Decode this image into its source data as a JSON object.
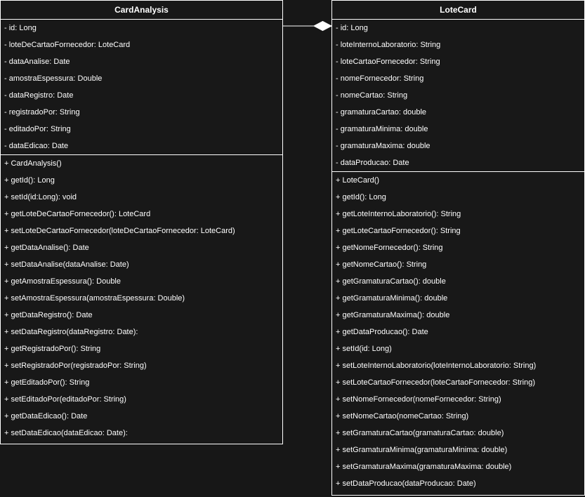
{
  "classes": [
    {
      "name": "CardAnalysis",
      "attributes": [
        "- id: Long",
        "- loteDeCartaoFornecedor: LoteCard",
        "- dataAnalise: Date",
        "- amostraEspessura: Double",
        "- dataRegistro: Date",
        "- registradoPor: String",
        "- editadoPor: String",
        "- dataEdicao: Date"
      ],
      "methods": [
        "+ CardAnalysis()",
        "+ getId(): Long",
        "+ setId(id:Long): void",
        "+ getLoteDeCartaoFornecedor(): LoteCard",
        "+ setLoteDeCartaoFornecedor(loteDeCartaoFornecedor: LoteCard)",
        "+ getDataAnalise(): Date",
        "+ setDataAnalise(dataAnalise: Date)",
        "+ getAmostraEspessura(): Double",
        "+ setAmostraEspessura(amostraEspessura: Double)",
        "+ getDataRegistro(): Date",
        "+ setDataRegistro(dataRegistro: Date):",
        "+ getRegistradoPor(): String",
        "+ setRegistradoPor(registradoPor: String)",
        "+ getEditadoPor(): String",
        "+ setEditadoPor(editadoPor: String)",
        "+ getDataEdicao(): Date",
        "+ setDataEdicao(dataEdicao: Date):"
      ]
    },
    {
      "name": "LoteCard",
      "attributes": [
        "- id: Long",
        "- loteInternoLaboratorio: String",
        "- loteCartaoFornecedor: String",
        "- nomeFornecedor: String",
        "- nomeCartao: String",
        "- gramaturaCartao: double",
        "- gramaturaMinima: double",
        "- gramaturaMaxima: double",
        "- dataProducao: Date"
      ],
      "methods": [
        "+ LoteCard()",
        "+ getId(): Long",
        "+ getLoteInternoLaboratorio(): String",
        "+ getLoteCartaoFornecedor(): String",
        "+ getNomeFornecedor(): String",
        "+ getNomeCartao(): String",
        "+ getGramaturaCartao(): double",
        "+ getGramaturaMinima(): double",
        "+ getGramaturaMaxima(): double",
        "+ getDataProducao(): Date",
        "+ setId(id: Long)",
        "+ setLoteInternoLaboratorio(loteInternoLaboratorio: String)",
        "+ setLoteCartaoFornecedor(loteCartaoFornecedor: String)",
        "+ setNomeFornecedor(nomeFornecedor: String)",
        "+ setNomeCartao(nomeCartao: String)",
        "+ setGramaturaCartao(gramaturaCartao: double)",
        "+ setGramaturaMinima(gramaturaMinima: double)",
        "+ setGramaturaMaxima(gramaturaMaxima: double)",
        "+ setDataProducao(dataProducao: Date)"
      ]
    }
  ],
  "relationship": {
    "type": "aggregation",
    "line_color": "#ffffff"
  },
  "colors": {
    "background": "#171717",
    "class_fill": "#181818",
    "border": "#ffffff",
    "text": "#ffffff"
  }
}
